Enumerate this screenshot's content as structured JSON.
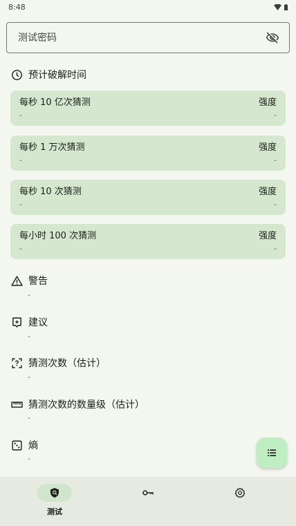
{
  "status_bar": {
    "time": "8:48"
  },
  "password_field": {
    "placeholder": "测试密码",
    "value": ""
  },
  "crack_time": {
    "title": "预计破解时间",
    "cards": [
      {
        "label": "每秒 10 亿次猜测",
        "strength_label": "强度",
        "time": "-",
        "strength": "-"
      },
      {
        "label": "每秒 1 万次猜测",
        "strength_label": "强度",
        "time": "-",
        "strength": "-"
      },
      {
        "label": "每秒 10 次猜测",
        "strength_label": "强度",
        "time": "-",
        "strength": "-"
      },
      {
        "label": "每小时 100 次猜测",
        "strength_label": "强度",
        "time": "-",
        "strength": "-"
      }
    ]
  },
  "warning": {
    "title": "警告",
    "value": "-"
  },
  "suggestions": {
    "title": "建议",
    "value": "-"
  },
  "guesses": {
    "title": "猜测次数（估计）",
    "value": "-"
  },
  "guesses_log10": {
    "title": "猜测次数的数量级（估计）",
    "value": "-"
  },
  "entropy": {
    "title": "熵",
    "value": "-"
  },
  "bottom_nav": {
    "items": [
      {
        "label": "测试",
        "icon": "shield-search-icon",
        "active": true
      },
      {
        "label": "",
        "icon": "key-icon",
        "active": false
      },
      {
        "label": "",
        "icon": "gear-icon",
        "active": false
      }
    ]
  },
  "colors": {
    "background": "#f4f7ef",
    "card": "#d5e8cf",
    "fab": "#bfeec3",
    "nav": "#e6eae0"
  }
}
